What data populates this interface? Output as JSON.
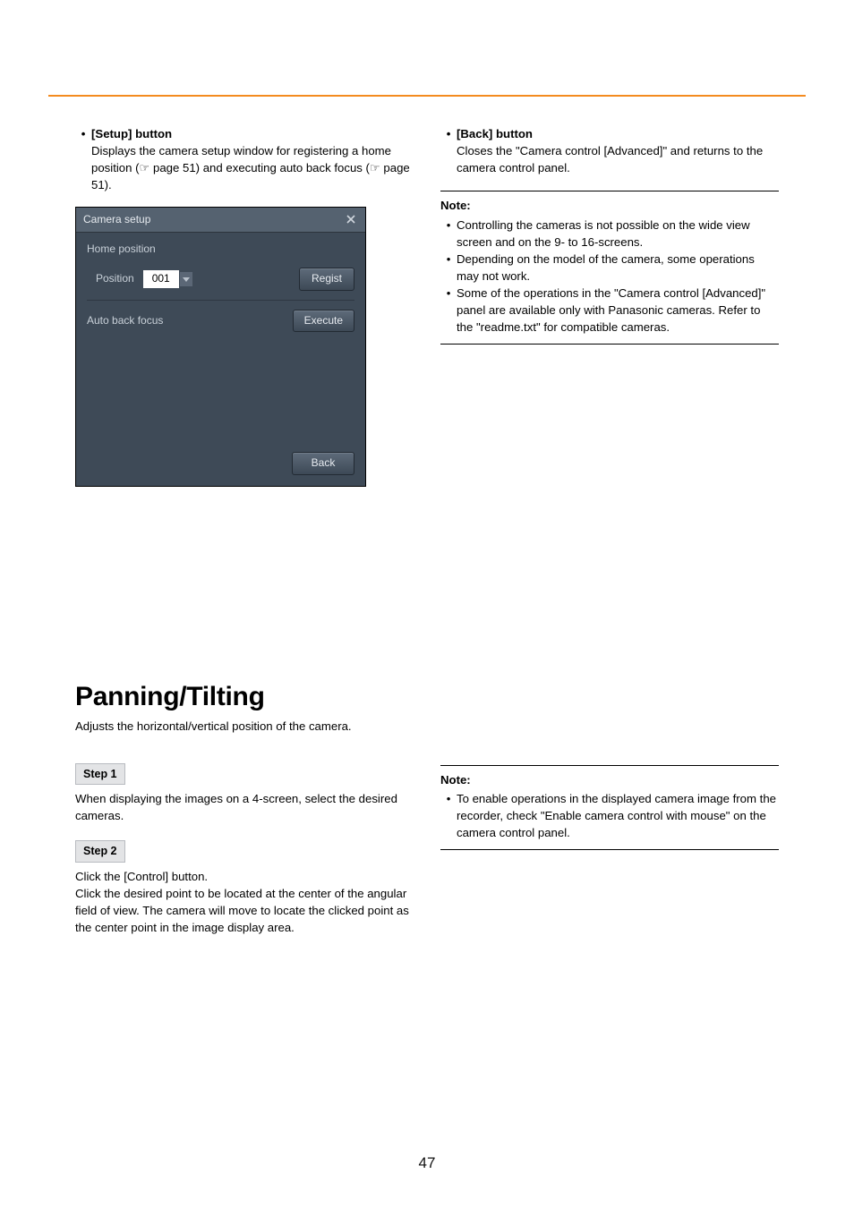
{
  "top": {
    "setup": {
      "heading_bullet": "•",
      "heading": "[Setup] button",
      "desc_1": "Displays the camera setup window for registering a home position (☞ page 51) and executing auto back focus (☞ page 51)."
    },
    "panel": {
      "title": "Camera setup",
      "home_position_label": "Home position",
      "position_label": "Position",
      "position_value": "001",
      "regist_btn": "Regist",
      "auto_back_focus_label": "Auto back focus",
      "execute_btn": "Execute",
      "back_btn": "Back"
    },
    "back": {
      "heading_bullet": "•",
      "heading": "[Back] button",
      "desc": "Closes the \"Camera control [Advanced]\" and returns to the camera control panel."
    },
    "note": {
      "label": "Note:",
      "b1_dot": "•",
      "b1": "Controlling the cameras is not possible on the wide view screen and on the 9- to 16-screens.",
      "b2_dot": "•",
      "b2": "Depending on the model of the camera, some operations may not work.",
      "b3_dot": "•",
      "b3": "Some of the operations in the \"Camera control [Advanced]\" panel are available only with Panasonic cameras. Refer to the \"readme.txt\" for compatible cameras."
    }
  },
  "section2": {
    "title": "Panning/Tilting",
    "subdesc": "Adjusts the horizontal/vertical position of the camera.",
    "step1_label": "Step 1",
    "step1_text": "When displaying the images on a 4-screen, select the desired cameras.",
    "step2_label": "Step 2",
    "step2_line1": "Click the [Control] button.",
    "step2_rest": "Click the desired point to be located at the center of the angular field of view. The camera will move to locate the clicked point as the center point in the image display area.",
    "note": {
      "label": "Note:",
      "b1_dot": "•",
      "b1": "To enable operations in the displayed camera image from the recorder, check \"Enable camera control with mouse\" on the camera control panel."
    }
  },
  "page_number": "47"
}
